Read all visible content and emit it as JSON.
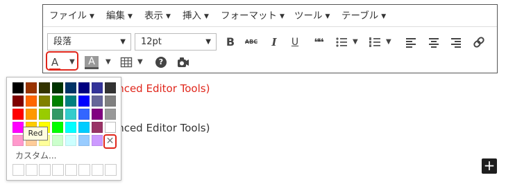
{
  "menubar": {
    "items": [
      {
        "label": "ファイル"
      },
      {
        "label": "編集"
      },
      {
        "label": "表示"
      },
      {
        "label": "挿入"
      },
      {
        "label": "フォーマット"
      },
      {
        "label": "ツール"
      },
      {
        "label": "テーブル"
      }
    ],
    "caret": "▼"
  },
  "toolbar": {
    "block_format": "段落",
    "font_size": "12pt",
    "caret": "▼",
    "bold_label": "B",
    "strike_label": "ABC",
    "italic_label": "I",
    "underline_label": "U",
    "quote_label": "❝❝",
    "text_color_label": "A",
    "bg_color_label": "A",
    "help_label": "?"
  },
  "content": {
    "line1": "anced Editor Tools)",
    "line2": "anced Editor Tools)",
    "line1_color": "#e0261b"
  },
  "color_picker": {
    "swatches": [
      [
        "#000000",
        "#993300",
        "#333300",
        "#003300",
        "#003366",
        "#000080",
        "#333399",
        "#333333"
      ],
      [
        "#800000",
        "#ff6600",
        "#808000",
        "#008000",
        "#008080",
        "#0000ff",
        "#666699",
        "#808080"
      ],
      [
        "#ff0000",
        "#ff9900",
        "#99cc00",
        "#339966",
        "#33cccc",
        "#3366ff",
        "#800080",
        "#999999"
      ],
      [
        "#ff00ff",
        "#ffcc00",
        "#ffff00",
        "#00ff00",
        "#00ffff",
        "#00ccff",
        "#993366",
        "#ffffff"
      ],
      [
        "#ff99cc",
        "#ffcc99",
        "#ffff99",
        "#ccffcc",
        "#ccffff",
        "#99ccff",
        "#cc99ff",
        ""
      ]
    ],
    "custom_label": "カスタム...",
    "remove_label": "✕",
    "tooltip": "Red"
  },
  "highlight_color": "#e0261b",
  "plus_label": "+"
}
